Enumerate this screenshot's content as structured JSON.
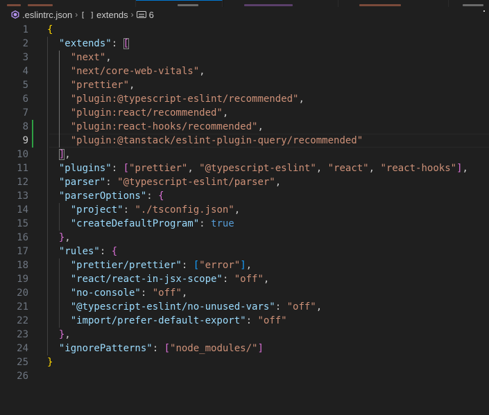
{
  "breadcrumb": {
    "file": ".eslintrc.json",
    "array_glyph": "[ ]",
    "key": "extends",
    "element_index": "6"
  },
  "colors": {
    "key": "#9cdcfe",
    "string": "#ce9178",
    "punct": "#cccccc",
    "literal": "#569cd6",
    "bracket_level1": "#ffd700",
    "bracket_level2": "#da70d6",
    "bracket_level3": "#179fff",
    "modified_gutter": "#2ea043"
  },
  "editor": {
    "current_line": 9,
    "lines": [
      {
        "n": "1",
        "tokens": [
          [
            "b1",
            "{"
          ]
        ]
      },
      {
        "n": "2",
        "tokens": [
          [
            "p",
            "  "
          ],
          [
            "k",
            "\"extends\""
          ],
          [
            "p",
            ": "
          ],
          [
            "b2m",
            "["
          ]
        ]
      },
      {
        "n": "3",
        "tokens": [
          [
            "p",
            "    "
          ],
          [
            "s",
            "\"next\""
          ],
          [
            "p",
            ","
          ]
        ]
      },
      {
        "n": "4",
        "tokens": [
          [
            "p",
            "    "
          ],
          [
            "s",
            "\"next/core-web-vitals\""
          ],
          [
            "p",
            ","
          ]
        ]
      },
      {
        "n": "5",
        "tokens": [
          [
            "p",
            "    "
          ],
          [
            "s",
            "\"prettier\""
          ],
          [
            "p",
            ","
          ]
        ]
      },
      {
        "n": "6",
        "tokens": [
          [
            "p",
            "    "
          ],
          [
            "s",
            "\"plugin:@typescript-eslint/recommended\""
          ],
          [
            "p",
            ","
          ]
        ]
      },
      {
        "n": "7",
        "tokens": [
          [
            "p",
            "    "
          ],
          [
            "s",
            "\"plugin:react/recommended\""
          ],
          [
            "p",
            ","
          ]
        ]
      },
      {
        "n": "8",
        "tokens": [
          [
            "p",
            "    "
          ],
          [
            "s",
            "\"plugin:react-hooks/recommended\""
          ],
          [
            "p",
            ","
          ]
        ]
      },
      {
        "n": "9",
        "tokens": [
          [
            "p",
            "    "
          ],
          [
            "s",
            "\"plugin:@tanstack/eslint-plugin-query/recommended\""
          ]
        ]
      },
      {
        "n": "10",
        "tokens": [
          [
            "p",
            "  "
          ],
          [
            "b2m",
            "]"
          ],
          [
            "p",
            ","
          ]
        ]
      },
      {
        "n": "11",
        "tokens": [
          [
            "p",
            "  "
          ],
          [
            "k",
            "\"plugins\""
          ],
          [
            "p",
            ": "
          ],
          [
            "b2",
            "["
          ],
          [
            "s",
            "\"prettier\""
          ],
          [
            "p",
            ", "
          ],
          [
            "s",
            "\"@typescript-eslint\""
          ],
          [
            "p",
            ", "
          ],
          [
            "s",
            "\"react\""
          ],
          [
            "p",
            ", "
          ],
          [
            "s",
            "\"react-hooks\""
          ],
          [
            "b2",
            "]"
          ],
          [
            "p",
            ","
          ]
        ]
      },
      {
        "n": "12",
        "tokens": [
          [
            "p",
            "  "
          ],
          [
            "k",
            "\"parser\""
          ],
          [
            "p",
            ": "
          ],
          [
            "s",
            "\"@typescript-eslint/parser\""
          ],
          [
            "p",
            ","
          ]
        ]
      },
      {
        "n": "13",
        "tokens": [
          [
            "p",
            "  "
          ],
          [
            "k",
            "\"parserOptions\""
          ],
          [
            "p",
            ": "
          ],
          [
            "b2",
            "{"
          ]
        ]
      },
      {
        "n": "14",
        "tokens": [
          [
            "p",
            "    "
          ],
          [
            "k",
            "\"project\""
          ],
          [
            "p",
            ": "
          ],
          [
            "s",
            "\"./tsconfig.json\""
          ],
          [
            "p",
            ","
          ]
        ]
      },
      {
        "n": "15",
        "tokens": [
          [
            "p",
            "    "
          ],
          [
            "k",
            "\"createDefaultProgram\""
          ],
          [
            "p",
            ": "
          ],
          [
            "t",
            "true"
          ]
        ]
      },
      {
        "n": "16",
        "tokens": [
          [
            "p",
            "  "
          ],
          [
            "b2",
            "}"
          ],
          [
            "p",
            ","
          ]
        ]
      },
      {
        "n": "17",
        "tokens": [
          [
            "p",
            "  "
          ],
          [
            "k",
            "\"rules\""
          ],
          [
            "p",
            ": "
          ],
          [
            "b2",
            "{"
          ]
        ]
      },
      {
        "n": "18",
        "tokens": [
          [
            "p",
            "    "
          ],
          [
            "k",
            "\"prettier/prettier\""
          ],
          [
            "p",
            ": "
          ],
          [
            "b3",
            "["
          ],
          [
            "s",
            "\"error\""
          ],
          [
            "b3",
            "]"
          ],
          [
            "p",
            ","
          ]
        ]
      },
      {
        "n": "19",
        "tokens": [
          [
            "p",
            "    "
          ],
          [
            "k",
            "\"react/react-in-jsx-scope\""
          ],
          [
            "p",
            ": "
          ],
          [
            "s",
            "\"off\""
          ],
          [
            "p",
            ","
          ]
        ]
      },
      {
        "n": "20",
        "tokens": [
          [
            "p",
            "    "
          ],
          [
            "k",
            "\"no-console\""
          ],
          [
            "p",
            ": "
          ],
          [
            "s",
            "\"off\""
          ],
          [
            "p",
            ","
          ]
        ]
      },
      {
        "n": "21",
        "tokens": [
          [
            "p",
            "    "
          ],
          [
            "k",
            "\"@typescript-eslint/no-unused-vars\""
          ],
          [
            "p",
            ": "
          ],
          [
            "s",
            "\"off\""
          ],
          [
            "p",
            ","
          ]
        ]
      },
      {
        "n": "22",
        "tokens": [
          [
            "p",
            "    "
          ],
          [
            "k",
            "\"import/prefer-default-export\""
          ],
          [
            "p",
            ": "
          ],
          [
            "s",
            "\"off\""
          ]
        ]
      },
      {
        "n": "23",
        "tokens": [
          [
            "p",
            "  "
          ],
          [
            "b2",
            "}"
          ],
          [
            "p",
            ","
          ]
        ]
      },
      {
        "n": "24",
        "tokens": [
          [
            "p",
            "  "
          ],
          [
            "k",
            "\"ignorePatterns\""
          ],
          [
            "p",
            ": "
          ],
          [
            "b2",
            "["
          ],
          [
            "s",
            "\"node_modules/\""
          ],
          [
            "b2",
            "]"
          ]
        ]
      },
      {
        "n": "25",
        "tokens": [
          [
            "b1",
            "}"
          ]
        ]
      },
      {
        "n": "26",
        "tokens": []
      }
    ]
  }
}
